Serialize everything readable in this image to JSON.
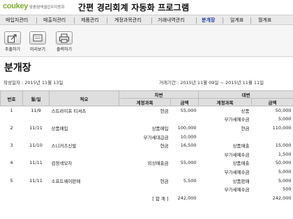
{
  "header": {
    "logo": "coukey",
    "logo_sub": "맞춤형엑셀업무자동화",
    "title": "간편 경리회계 자동화 프로그램"
  },
  "menu": [
    {
      "label": "매입처관리",
      "active": false
    },
    {
      "label": "매출처관리",
      "active": false
    },
    {
      "label": "제품관리",
      "active": false
    },
    {
      "label": "계정과목관리",
      "active": false
    },
    {
      "label": "거래내역관리",
      "active": false
    },
    {
      "label": "분개장",
      "active": true
    },
    {
      "label": "일계표",
      "active": false
    },
    {
      "label": "월계표",
      "active": false
    }
  ],
  "toolbar": {
    "extract_label": "추출하기",
    "preview_label": "미리보기",
    "print_label": "출력하기"
  },
  "page": {
    "title": "분개장",
    "created_label": "작성일자 : 2015년 11월 13일",
    "period_label": "거래기간 : 2015년 11월 09일 ~ 2015년 11월 11일"
  },
  "table": {
    "headers": {
      "no": "번호",
      "date": "월/일",
      "summary": "적요",
      "debit": "차변",
      "credit": "대변",
      "account": "계정과목",
      "amount": "금액"
    },
    "rows": [
      {
        "no": "1",
        "date": "11/9",
        "summary": "스트라이프 티셔츠",
        "d_acct": "현금",
        "d_amt": "55,000",
        "c_acct": "상품",
        "c_amt": "50,000"
      },
      {
        "no": "",
        "date": "",
        "summary": "",
        "d_acct": "",
        "d_amt": "",
        "c_acct": "부가세예수금",
        "c_amt": "5,000"
      },
      {
        "no": "2",
        "date": "11/11",
        "summary": "상품매입",
        "d_acct": "상품매입",
        "d_amt": "100,000",
        "c_acct": "현금",
        "c_amt": "110,000"
      },
      {
        "no": "",
        "date": "",
        "summary": "",
        "d_acct": "부가세대급금",
        "d_amt": "10,000",
        "c_acct": "",
        "c_amt": ""
      },
      {
        "no": "3",
        "date": "11/10",
        "summary": "스니커즈신발",
        "d_acct": "현금",
        "d_amt": "16,500",
        "c_acct": "상품매출",
        "c_amt": "15,000"
      },
      {
        "no": "",
        "date": "",
        "summary": "",
        "d_acct": "",
        "d_amt": "",
        "c_acct": "부가세예수금",
        "c_amt": "1,500"
      },
      {
        "no": "4",
        "date": "11/11",
        "summary": "검정색모자",
        "d_acct": "외상매출금",
        "d_amt": "55,000",
        "c_acct": "상품매출",
        "c_amt": "50,000"
      },
      {
        "no": "",
        "date": "",
        "summary": "",
        "d_acct": "",
        "d_amt": "",
        "c_acct": "부가세예수금",
        "c_amt": "5,000"
      },
      {
        "no": "5",
        "date": "11/11",
        "summary": "소프트웨어판매",
        "d_acct": "현금",
        "d_amt": "5,500",
        "c_acct": "상품판매",
        "c_amt": "5,000"
      },
      {
        "no": "",
        "date": "",
        "summary": "",
        "d_acct": "",
        "d_amt": "",
        "c_acct": "부가세예수금",
        "c_amt": "500"
      }
    ],
    "total": {
      "label": "[ 합      계 ]",
      "debit": "242,000",
      "credit": "242,000"
    }
  }
}
